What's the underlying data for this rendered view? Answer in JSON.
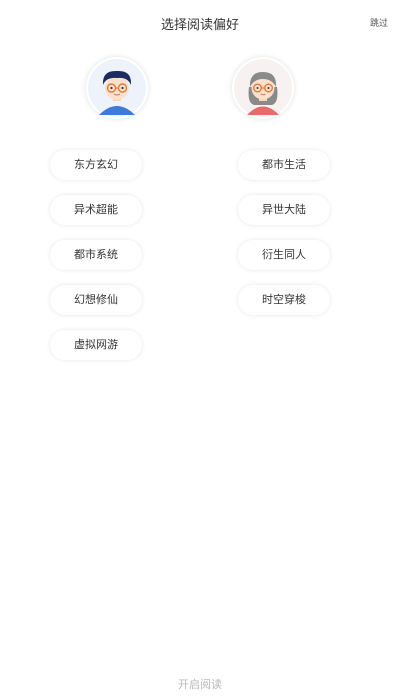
{
  "header": {
    "title": "选择阅读偏好",
    "skip_label": "跳过"
  },
  "avatars": {
    "boy": "boy-avatar-icon",
    "girl": "girl-avatar-icon"
  },
  "genres": {
    "left": [
      "东方玄幻",
      "异术超能",
      "都市系统",
      "幻想修仙",
      "虚拟网游"
    ],
    "right": [
      "都市生活",
      "异世大陆",
      "衍生同人",
      "时空穿梭"
    ]
  },
  "footer": {
    "start_label": "开启阅读"
  },
  "colors": {
    "boy_hair": "#1d2b5e",
    "boy_shirt": "#3d7bd9",
    "girl_hair": "#8a8a8a",
    "girl_shirt": "#e86b6b",
    "glasses": "#e07a3a",
    "disabled_text": "#b8b8b8"
  }
}
